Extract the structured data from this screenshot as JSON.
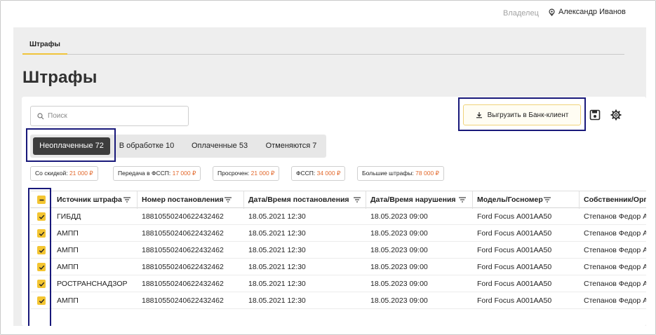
{
  "header": {
    "owner_label": "Владелец",
    "user_name": "Александр Иванов"
  },
  "page_tab": "Штрафы",
  "page_title": "Штрафы",
  "search": {
    "placeholder": "Поиск",
    "value": ""
  },
  "export_button": "Выгрузить в Банк-клиент",
  "status_tabs": [
    {
      "label": "Неоплаченные 72",
      "active": true
    },
    {
      "label": "В обработке 10",
      "active": false
    },
    {
      "label": "Оплаченные 53",
      "active": false
    },
    {
      "label": "Отменяются 7",
      "active": false
    }
  ],
  "chips": [
    {
      "label": "Со скидкой:",
      "amount": "21 000 ₽"
    },
    {
      "label": "Передача в ФССП:",
      "amount": "17 000 ₽"
    },
    {
      "label": "Просрочен:",
      "amount": "21 000 ₽"
    },
    {
      "label": "ФССП:",
      "amount": "34 000 ₽"
    },
    {
      "label": "Большие штрафы:",
      "amount": "78 000 ₽"
    }
  ],
  "table": {
    "columns": [
      "Источник штрафа",
      "Номер постановления",
      "Дата/Время постановления",
      "Дата/Время нарушения",
      "Модель/Госномер",
      "Собственник/Орга"
    ],
    "rows": [
      {
        "source": "ГИБДД",
        "number": "18810550240622432462",
        "decree_date": "18.05.2021 12:30",
        "violation_date": "18.05.2023 09:00",
        "vehicle": "Ford Focus А001АА50",
        "owner": "Степанов Федор А",
        "checked": true
      },
      {
        "source": "АМПП",
        "number": "18810550240622432462",
        "decree_date": "18.05.2021 12:30",
        "violation_date": "18.05.2023 09:00",
        "vehicle": "Ford Focus А001АА50",
        "owner": "Степанов Федор А",
        "checked": true
      },
      {
        "source": "АМПП",
        "number": "18810550240622432462",
        "decree_date": "18.05.2021 12:30",
        "violation_date": "18.05.2023 09:00",
        "vehicle": "Ford Focus А001АА50",
        "owner": "Степанов Федор А",
        "checked": true
      },
      {
        "source": "АМПП",
        "number": "18810550240622432462",
        "decree_date": "18.05.2021 12:30",
        "violation_date": "18.05.2023 09:00",
        "vehicle": "Ford Focus А001АА50",
        "owner": "Степанов Федор А",
        "checked": true
      },
      {
        "source": "РОСТРАНСНАДЗОР",
        "number": "18810550240622432462",
        "decree_date": "18.05.2021 12:30",
        "violation_date": "18.05.2023 09:00",
        "vehicle": "Ford Focus А001АА50",
        "owner": "Степанов Федор А",
        "checked": true
      },
      {
        "source": "АМПП",
        "number": "18810550240622432462",
        "decree_date": "18.05.2021 12:30",
        "violation_date": "18.05.2023 09:00",
        "vehicle": "Ford Focus А001АА50",
        "owner": "Степанов Федор А",
        "checked": true
      }
    ]
  },
  "colors": {
    "accent": "#f4c531",
    "annotation": "#18187a",
    "amount": "#e2672a",
    "active_tab": "#3d3d3d"
  },
  "icons": [
    "location-pin-icon",
    "search-icon",
    "download-icon",
    "save-icon",
    "gear-icon",
    "filter-icon",
    "checkbox-indeterminate-icon",
    "checkmark-icon",
    "arrow-down-right-icon"
  ]
}
